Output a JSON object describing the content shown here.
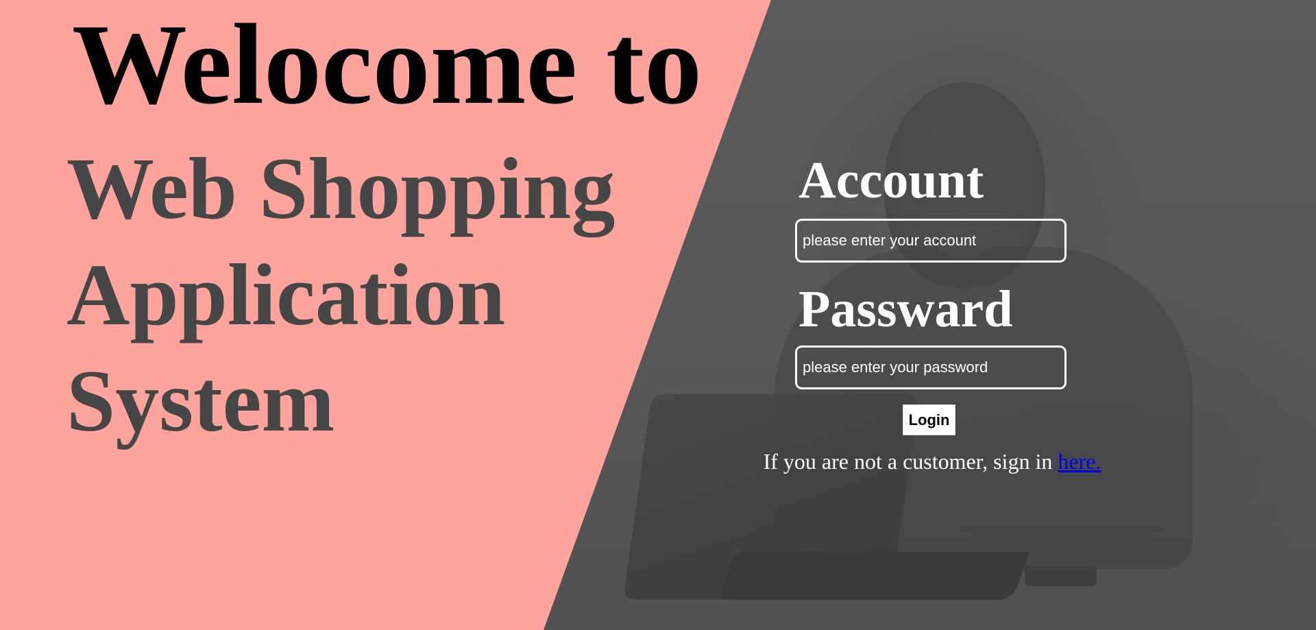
{
  "hero": {
    "line1": "Welocome to",
    "line2": "Web Shopping Application System"
  },
  "login": {
    "account_label": "Account",
    "account_placeholder": "please enter your account",
    "password_label": "Passward",
    "password_placeholder": "please enter your password",
    "login_button": "Login",
    "signup_text": "If you are not a customer, sign in",
    "signup_link": "here."
  },
  "colors": {
    "left_background": "#ffa39d",
    "right_overlay": "#555555",
    "hero_line1": "#000000",
    "hero_line2": "#464646",
    "form_text": "#ffffff",
    "link": "#0000ee"
  },
  "background_image": {
    "icon": "person-with-laptop-photo"
  }
}
